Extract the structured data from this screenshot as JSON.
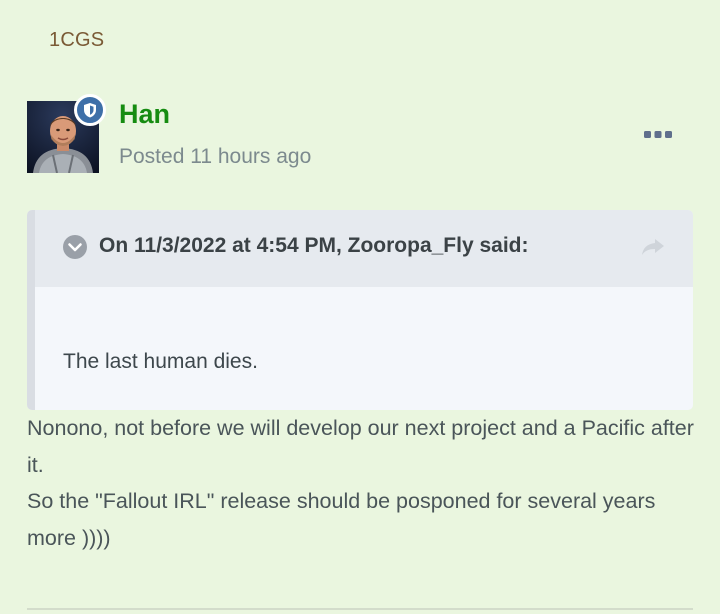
{
  "previous_post": {
    "author": "1CGS"
  },
  "post": {
    "author": "Han",
    "timestamp": "Posted 11 hours ago",
    "badge_icon": "shield-icon",
    "options_icon": "ellipsis-icon",
    "quote": {
      "citation": "On 11/3/2022 at 4:54 PM, Zooropa_Fly said:",
      "text": "The last human dies.",
      "toggle_icon": "chevron-down-icon",
      "share_icon": "share-arrow-icon"
    },
    "body": {
      "line1": "Nonono, not before we will develop our next project and a Pacific after it.",
      "line2": "So the \"Fallout IRL\" release should be posponed for several years more  ))))"
    }
  },
  "colors": {
    "background": "#eaf6df",
    "author_name": "#168c11",
    "badge": "#3e6fa8",
    "quote_background": "#f4f7fb",
    "quote_header": "#e6eaef"
  }
}
